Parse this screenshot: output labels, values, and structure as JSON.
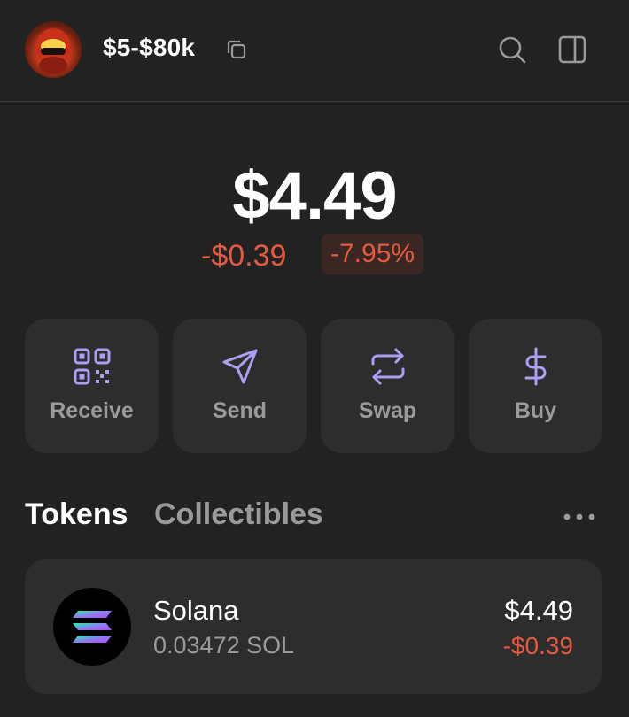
{
  "header": {
    "account_name": "$5-$80k",
    "icons": {
      "avatar": "avatar",
      "copy": "copy-icon",
      "search": "search-icon",
      "panel": "sidebar-panel-icon"
    }
  },
  "balance": {
    "total": "$4.49",
    "change_amount": "-$0.39",
    "change_percent": "-7.95%"
  },
  "actions": [
    {
      "label": "Receive",
      "icon": "qr-code-icon"
    },
    {
      "label": "Send",
      "icon": "send-icon"
    },
    {
      "label": "Swap",
      "icon": "swap-icon"
    },
    {
      "label": "Buy",
      "icon": "dollar-icon"
    }
  ],
  "tabs": {
    "tokens": "Tokens",
    "collectibles": "Collectibles",
    "more_icon": "more-icon"
  },
  "tokens": [
    {
      "name": "Solana",
      "amount": "0.03472 SOL",
      "value": "$4.49",
      "change": "-$0.39",
      "icon": "solana-logo"
    }
  ],
  "colors": {
    "background": "#222222",
    "card": "#2d2d2d",
    "accent": "#ab9ff2",
    "negative": "#e5593d",
    "muted": "#9a9a9a"
  }
}
